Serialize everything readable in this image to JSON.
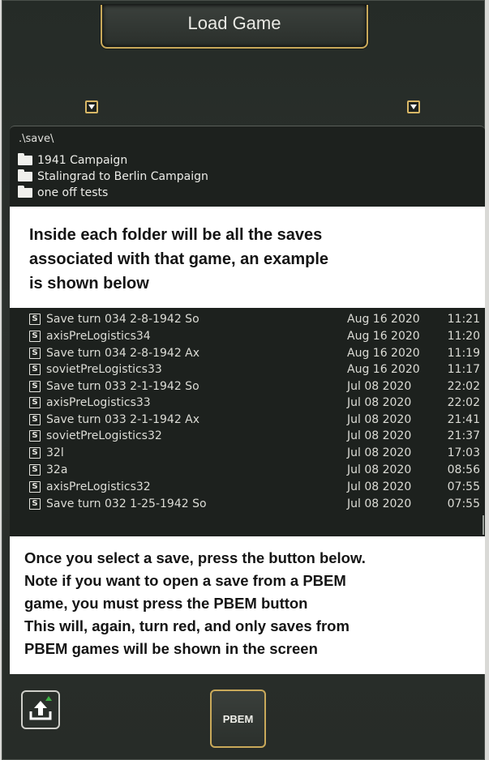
{
  "window": {
    "title": "Load Game"
  },
  "folders": {
    "path": ".\\save\\",
    "items": [
      "1941 Campaign",
      "Stalingrad to Berlin Campaign",
      "one off tests"
    ]
  },
  "callouts": {
    "top": [
      "Inside each folder will be all the saves",
      "associated with that game, an example",
      "is shown below"
    ],
    "bottom": [
      "Once you select a save, press the button below.",
      "Note if you want to open a save from a PBEM",
      "game, you must press the PBEM button",
      "This will, again, turn red, and only saves from",
      "PBEM games will be shown in the screen"
    ]
  },
  "saves": [
    {
      "name": "Save turn 034 2-8-1942 So",
      "date": "Aug 16 2020",
      "time": "11:21"
    },
    {
      "name": "axisPreLogistics34",
      "date": "Aug 16 2020",
      "time": "11:20"
    },
    {
      "name": "Save turn 034 2-8-1942 Ax",
      "date": "Aug 16 2020",
      "time": "11:19"
    },
    {
      "name": "sovietPreLogistics33",
      "date": "Aug 16 2020",
      "time": "11:17"
    },
    {
      "name": "Save turn 033 2-1-1942 So",
      "date": "Jul  08 2020",
      "time": "22:02"
    },
    {
      "name": "axisPreLogistics33",
      "date": "Jul  08 2020",
      "time": "22:02"
    },
    {
      "name": "Save turn 033 2-1-1942 Ax",
      "date": "Jul  08 2020",
      "time": "21:41"
    },
    {
      "name": "sovietPreLogistics32",
      "date": "Jul  08 2020",
      "time": "21:37"
    },
    {
      "name": "32l",
      "date": "Jul  08 2020",
      "time": "17:03"
    },
    {
      "name": "32a",
      "date": "Jul  08 2020",
      "time": "08:56"
    },
    {
      "name": "axisPreLogistics32",
      "date": "Jul  08 2020",
      "time": "07:55"
    },
    {
      "name": "Save turn 032 1-25-1942 So",
      "date": "Jul  08 2020",
      "time": "07:55"
    }
  ],
  "save_icon_glyph": "S",
  "buttons": {
    "pbem_label": "PBEM",
    "upload_icon": "upload-icon"
  },
  "colors": {
    "accent_gold": "#c9a95a",
    "panel_bg": "#252b27",
    "upload_green": "#3cb043"
  }
}
